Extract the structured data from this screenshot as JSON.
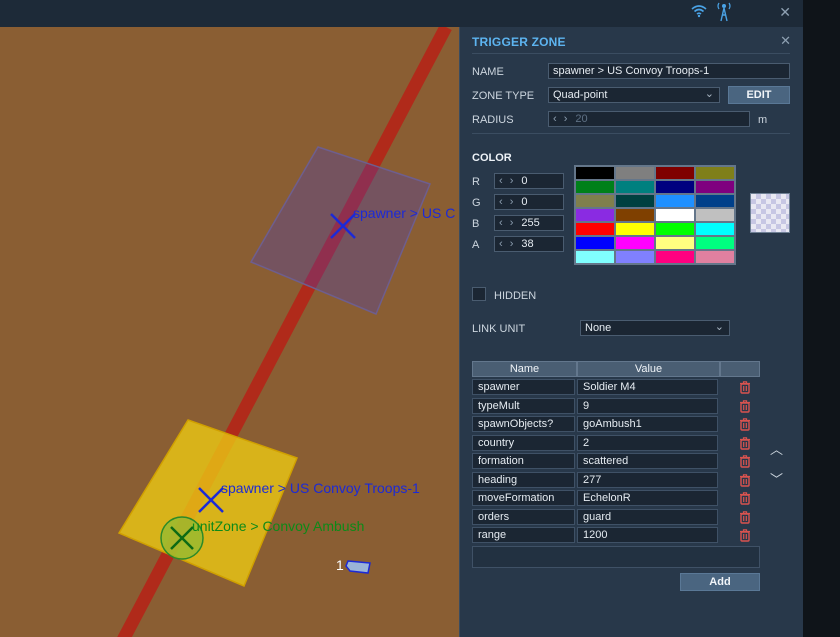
{
  "top_bar": {
    "wifi_icon": "wifi-icon",
    "antenna_icon": "antenna-icon",
    "close": "✕"
  },
  "map": {
    "zone1_label": "spawner > US C",
    "zone2_label": "spawner > US Convoy Troops-1",
    "zone3_label": "unitZone > Convoy Ambush",
    "unit_number": "1"
  },
  "panel": {
    "title": "TRIGGER ZONE",
    "close": "✕",
    "name_label": "NAME",
    "name_value": "spawner > US Convoy Troops-1",
    "zone_type_label": "ZONE TYPE",
    "zone_type_value": "Quad-point",
    "edit_button": "EDIT",
    "radius_label": "RADIUS",
    "radius_value": "20",
    "radius_unit": "m",
    "color_label": "COLOR",
    "rgba": [
      {
        "label": "R",
        "value": "0"
      },
      {
        "label": "G",
        "value": "0"
      },
      {
        "label": "B",
        "value": "255"
      },
      {
        "label": "A",
        "value": "38"
      }
    ],
    "palette": [
      "#000000",
      "#7f7f7f",
      "#7f0000",
      "#7f7f1a",
      "#00801a",
      "#00807f",
      "#00007f",
      "#7f007f",
      "#7f7f4d",
      "#004040",
      "#1e90ff",
      "#00408a",
      "#8a2be2",
      "#7f4000",
      "#ffffff",
      "#c0c0c0",
      "#ff0000",
      "#ffff00",
      "#00ff00",
      "#00ffff",
      "#0000ff",
      "#ff00ff",
      "#ffff80",
      "#00ff80",
      "#80ffff",
      "#8080ff",
      "#ff0080",
      "#e080a0"
    ],
    "hidden_label": "HIDDEN",
    "link_unit_label": "LINK UNIT",
    "link_unit_value": "None",
    "table": {
      "headers": [
        "Name",
        "Value"
      ],
      "rows": [
        {
          "name": "spawner",
          "value": "Soldier M4"
        },
        {
          "name": "typeMult",
          "value": "9"
        },
        {
          "name": "spawnObjects?",
          "value": "goAmbush1"
        },
        {
          "name": "country",
          "value": "2"
        },
        {
          "name": "formation",
          "value": "scattered"
        },
        {
          "name": "heading",
          "value": "277"
        },
        {
          "name": "moveFormation",
          "value": "EchelonR"
        },
        {
          "name": "orders",
          "value": "guard"
        },
        {
          "name": "range",
          "value": "1200"
        }
      ]
    },
    "add_button": "Add",
    "scroll_up": "︿",
    "scroll_down": "﹀"
  },
  "colors": {
    "accent": "#5db4f0",
    "map_ground": "#8a5e33",
    "road": "#b02a1a",
    "trash": "#d9534f"
  }
}
